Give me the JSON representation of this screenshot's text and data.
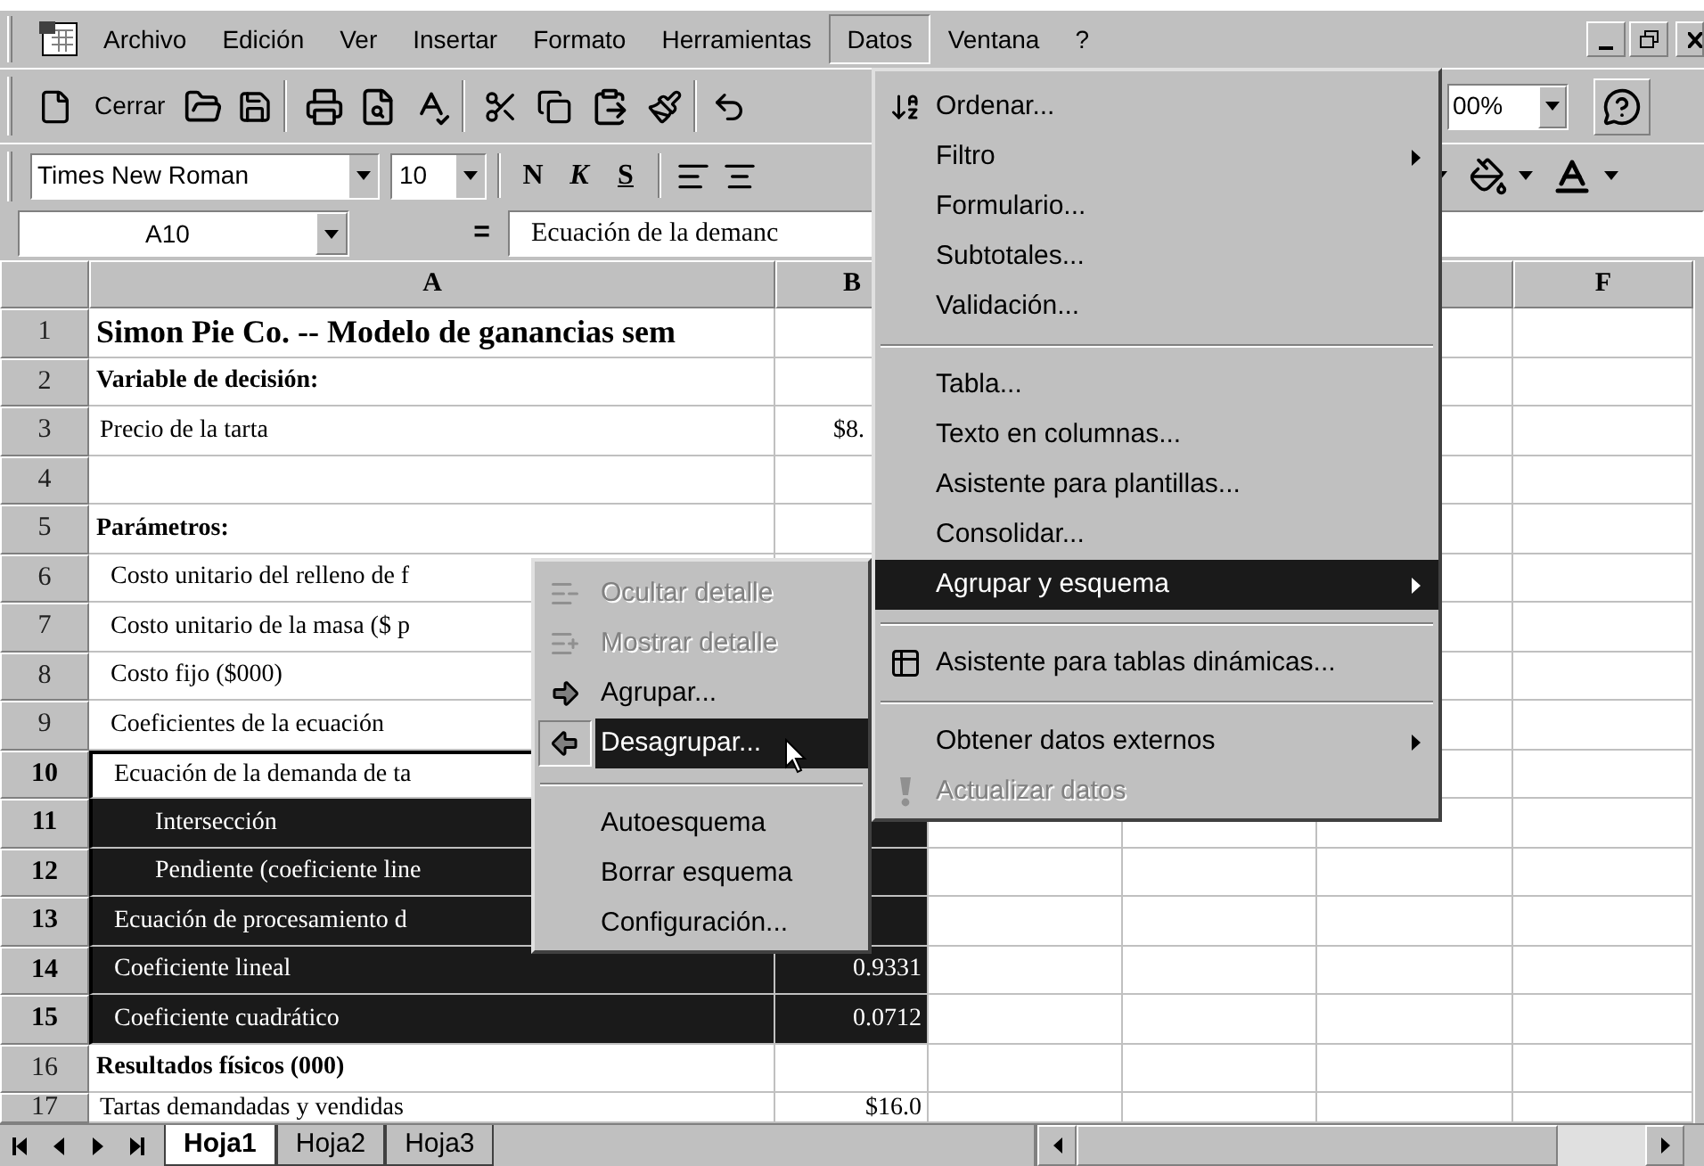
{
  "menu_bar": {
    "items": [
      {
        "label": "Archivo",
        "selected": false
      },
      {
        "label": "Edición",
        "selected": false
      },
      {
        "label": "Ver",
        "selected": false
      },
      {
        "label": "Insertar",
        "selected": false
      },
      {
        "label": "Formato",
        "selected": false
      },
      {
        "label": "Herramientas",
        "selected": false
      },
      {
        "label": "Datos",
        "selected": true
      },
      {
        "label": "Ventana",
        "selected": false
      },
      {
        "label": "?",
        "selected": false
      }
    ]
  },
  "standard_toolbar": {
    "close_button": "Cerrar",
    "zoom_field": "00%"
  },
  "format_toolbar": {
    "font_field": "Times New Roman",
    "size_field": "10",
    "bold_button": "N",
    "italic_button": "K",
    "underline_button": "S"
  },
  "formula_bar": {
    "name_box": "A10",
    "equals_sign": "=",
    "content": "Ecuación de la demanc"
  },
  "columns": [
    "A",
    "B",
    "F"
  ],
  "rows": [
    {
      "number": "1",
      "kind": "title",
      "a": "Simon Pie Co. -- Modelo de ganancias sem",
      "selected": false,
      "active": false
    },
    {
      "number": "2",
      "kind": "heading",
      "a": "Variable de decisión:",
      "selected": false,
      "active": false
    },
    {
      "number": "3",
      "kind": "plain",
      "a": "Precio de la tarta",
      "b": "$8.",
      "selected": false,
      "active": false
    },
    {
      "number": "4",
      "selected": false,
      "active": false
    },
    {
      "number": "5",
      "kind": "heading",
      "a": "Parámetros:",
      "selected": false,
      "active": false
    },
    {
      "number": "6",
      "kind": "item",
      "a": "Costo unitario del relleno de f",
      "selected": false,
      "active": false
    },
    {
      "number": "7",
      "kind": "item",
      "a": "Costo unitario de la masa ($ p",
      "selected": false,
      "active": false
    },
    {
      "number": "8",
      "kind": "item",
      "a": "Costo fijo ($000)",
      "selected": false,
      "active": false
    },
    {
      "number": "9",
      "kind": "item",
      "a": "Coeficientes de la ecuación",
      "selected": false,
      "active": false
    },
    {
      "number": "10",
      "kind": "item",
      "a": "Ecuación de la demanda de ta",
      "selected": true,
      "active": true
    },
    {
      "number": "11",
      "kind": "subitem",
      "a": "Intersección",
      "selected": true,
      "active": false
    },
    {
      "number": "12",
      "kind": "subitem",
      "a": "Pendiente (coeficiente line",
      "selected": true,
      "active": false
    },
    {
      "number": "13",
      "kind": "item",
      "a": "Ecuación de procesamiento d",
      "selected": true,
      "active": false
    },
    {
      "number": "14",
      "kind": "item",
      "a": "Coeficiente lineal",
      "b": "0.9331",
      "selected": true,
      "active": false
    },
    {
      "number": "15",
      "kind": "item",
      "a": "Coeficiente cuadrático",
      "b": "0.0712",
      "selected": true,
      "active": false
    },
    {
      "number": "16",
      "kind": "heading",
      "a": "Resultados físicos (000)",
      "selected": false,
      "active": false
    },
    {
      "number": "17",
      "kind": "plain",
      "a": "Tartas demandadas y vendidas",
      "b": "$16.0",
      "selected": false,
      "active": false
    }
  ],
  "sheet_tabs": [
    {
      "label": "Hoja1",
      "selected": true
    },
    {
      "label": "Hoja2",
      "selected": false
    },
    {
      "label": "Hoja3",
      "selected": false
    }
  ],
  "data_menu": {
    "items": [
      {
        "kind": "sort",
        "label": "Ordenar...",
        "submenu": false,
        "disabled": false,
        "selected": false
      },
      {
        "kind": "plain",
        "label": "Filtro",
        "submenu": true,
        "disabled": false,
        "selected": false
      },
      {
        "kind": "plain",
        "label": "Formulario...",
        "submenu": false,
        "disabled": false,
        "selected": false
      },
      {
        "kind": "plain",
        "label": "Subtotales...",
        "submenu": false,
        "disabled": false,
        "selected": false
      },
      {
        "kind": "plain",
        "label": "Validación...",
        "submenu": false,
        "disabled": false,
        "selected": false
      },
      {
        "kind": "separator"
      },
      {
        "kind": "plain",
        "label": "Tabla...",
        "submenu": false,
        "disabled": false,
        "selected": false
      },
      {
        "kind": "plain",
        "label": "Texto en columnas...",
        "submenu": false,
        "disabled": false,
        "selected": false
      },
      {
        "kind": "plain",
        "label": "Asistente para plantillas...",
        "submenu": false,
        "disabled": false,
        "selected": false
      },
      {
        "kind": "plain",
        "label": "Consolidar...",
        "submenu": false,
        "disabled": false,
        "selected": false
      },
      {
        "kind": "plain",
        "label": "Agrupar y esquema",
        "submenu": true,
        "disabled": false,
        "selected": true
      },
      {
        "kind": "separator"
      },
      {
        "kind": "pivot",
        "label": "Asistente para tablas dinámicas...",
        "submenu": false,
        "disabled": false,
        "selected": false
      },
      {
        "kind": "separator"
      },
      {
        "kind": "plain",
        "label": "Obtener datos externos",
        "submenu": true,
        "disabled": false,
        "selected": false
      },
      {
        "kind": "refresh",
        "label": "Actualizar datos",
        "submenu": false,
        "disabled": true,
        "selected": false
      }
    ]
  },
  "outline_submenu": {
    "items": [
      {
        "kind": "hide",
        "label": "Ocultar detalle",
        "disabled": true,
        "selected": false
      },
      {
        "kind": "show",
        "label": "Mostrar detalle",
        "disabled": true,
        "selected": false
      },
      {
        "kind": "group",
        "label": "Agrupar...",
        "disabled": false,
        "selected": false
      },
      {
        "kind": "ungroup",
        "label": "Desagrupar...",
        "disabled": false,
        "selected": true
      },
      {
        "kind": "separator"
      },
      {
        "kind": "plain",
        "label": "Autoesquema",
        "disabled": false,
        "selected": false
      },
      {
        "kind": "plain",
        "label": "Borrar esquema",
        "disabled": false,
        "selected": false
      },
      {
        "kind": "plain",
        "label": "Configuración...",
        "disabled": false,
        "selected": false
      }
    ]
  }
}
